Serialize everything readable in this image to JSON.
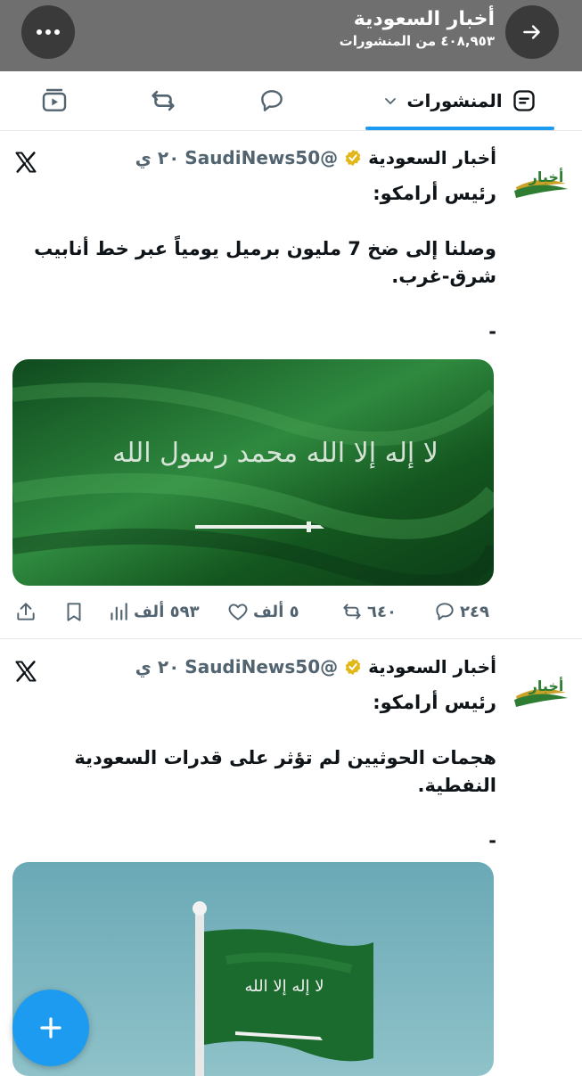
{
  "header": {
    "title": "أخبار السعودية",
    "posts_count": "٤٠٨,٩٥٣ من المنشورات",
    "back_icon": "arrow-right-icon",
    "more_icon": "more-dots-icon"
  },
  "tabs": {
    "active_label": "المنشورات",
    "active_icon": "posts-list-icon",
    "dropdown_icon": "chevron-down-icon",
    "other_tabs": [
      "replies-icon",
      "reposts-icon",
      "video-icon"
    ]
  },
  "posts": [
    {
      "author_name": "أخبار السعودية",
      "handle": "@SaudiNews50",
      "time": "٢٠ ي",
      "verified": true,
      "lines": [
        "رئيس أرامكو:",
        "",
        "وصلنا إلى ضخ 7 مليون برميل يومياً عبر خط أنابيب شرق-غرب.",
        "",
        "-"
      ],
      "media": "saudi-flag-fabric-image",
      "replies": "٢٤٩",
      "reposts": "٦٤٠",
      "likes": "٥ ألف",
      "views": "٥٩٣ ألف"
    },
    {
      "author_name": "أخبار السعودية",
      "handle": "@SaudiNews50",
      "time": "٢٠ ي",
      "verified": true,
      "lines": [
        "رئيس أرامكو:",
        "",
        "هجمات الحوثيين لم تؤثر على قدرات السعودية النفطية.",
        "",
        "-"
      ],
      "media": "saudi-flag-pole-image"
    }
  ],
  "colors": {
    "accent": "#1d9bf0",
    "flag_green": "#1b6b2e",
    "topbar": "#6f6f6f",
    "gold_badge": "#e2b719"
  }
}
